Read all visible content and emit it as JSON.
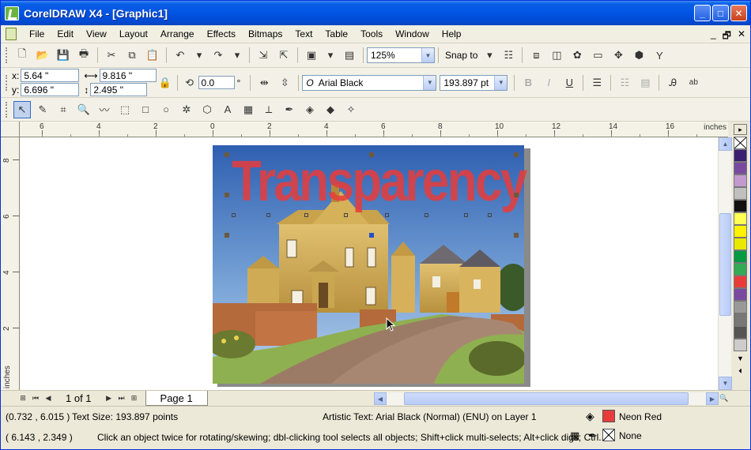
{
  "window": {
    "title": "CorelDRAW X4 - [Graphic1]",
    "controls": [
      "_",
      "□",
      "✕"
    ]
  },
  "menu": {
    "items": [
      "File",
      "Edit",
      "View",
      "Layout",
      "Arrange",
      "Effects",
      "Bitmaps",
      "Text",
      "Table",
      "Tools",
      "Window",
      "Help"
    ],
    "mdi_controls": [
      "_",
      "🗗",
      "✕"
    ]
  },
  "toolbar": {
    "zoom_value": "125%",
    "snap_to_label": "Snap to"
  },
  "property_bar": {
    "x_label": "x:",
    "x_value": "5.64 \"",
    "y_label": "y:",
    "y_value": "6.696 \"",
    "width_value": "9.816 \"",
    "height_value": "2.495 \"",
    "angle_value": "0.0",
    "angle_unit": "°",
    "font_name": "Arial Black",
    "font_size": "193.897 pt"
  },
  "ruler": {
    "h_labels": [
      "6",
      "4",
      "2",
      "0",
      "2",
      "4",
      "6",
      "8",
      "10",
      "12",
      "14",
      "16"
    ],
    "v_labels": [
      "8",
      "6",
      "4",
      "2"
    ],
    "unit": "inches"
  },
  "canvas": {
    "headline_text": "Transparency"
  },
  "palette": {
    "colors": [
      "#ffffff",
      "#3a1e72",
      "#7a4aa0",
      "#c29ad0",
      "#bfbfbf",
      "#111111",
      "#ffff55",
      "#fff200",
      "#e9e900",
      "#009944",
      "#33aa55",
      "#e83c3a",
      "#7a4aa0",
      "#999999",
      "#777777",
      "#555555",
      "#cccccc"
    ]
  },
  "navigation": {
    "page_count": "1 of 1",
    "page_tab": "Page 1"
  },
  "status": {
    "coords1": "(0.732 , 6.015 )",
    "text_size": "Text Size: 193.897 points",
    "object_info": "Artistic Text: Arial Black (Normal) (ENU) on Layer 1",
    "fill_name": "Neon Red",
    "fill_color": "#e83c3a",
    "coords2": "( 6.143 , 2.349 )",
    "hint": "Click an object twice for rotating/skewing; dbl-clicking tool selects all objects; Shift+click multi-selects; Alt+click digs; Ctrl...",
    "outline_name": "None"
  }
}
